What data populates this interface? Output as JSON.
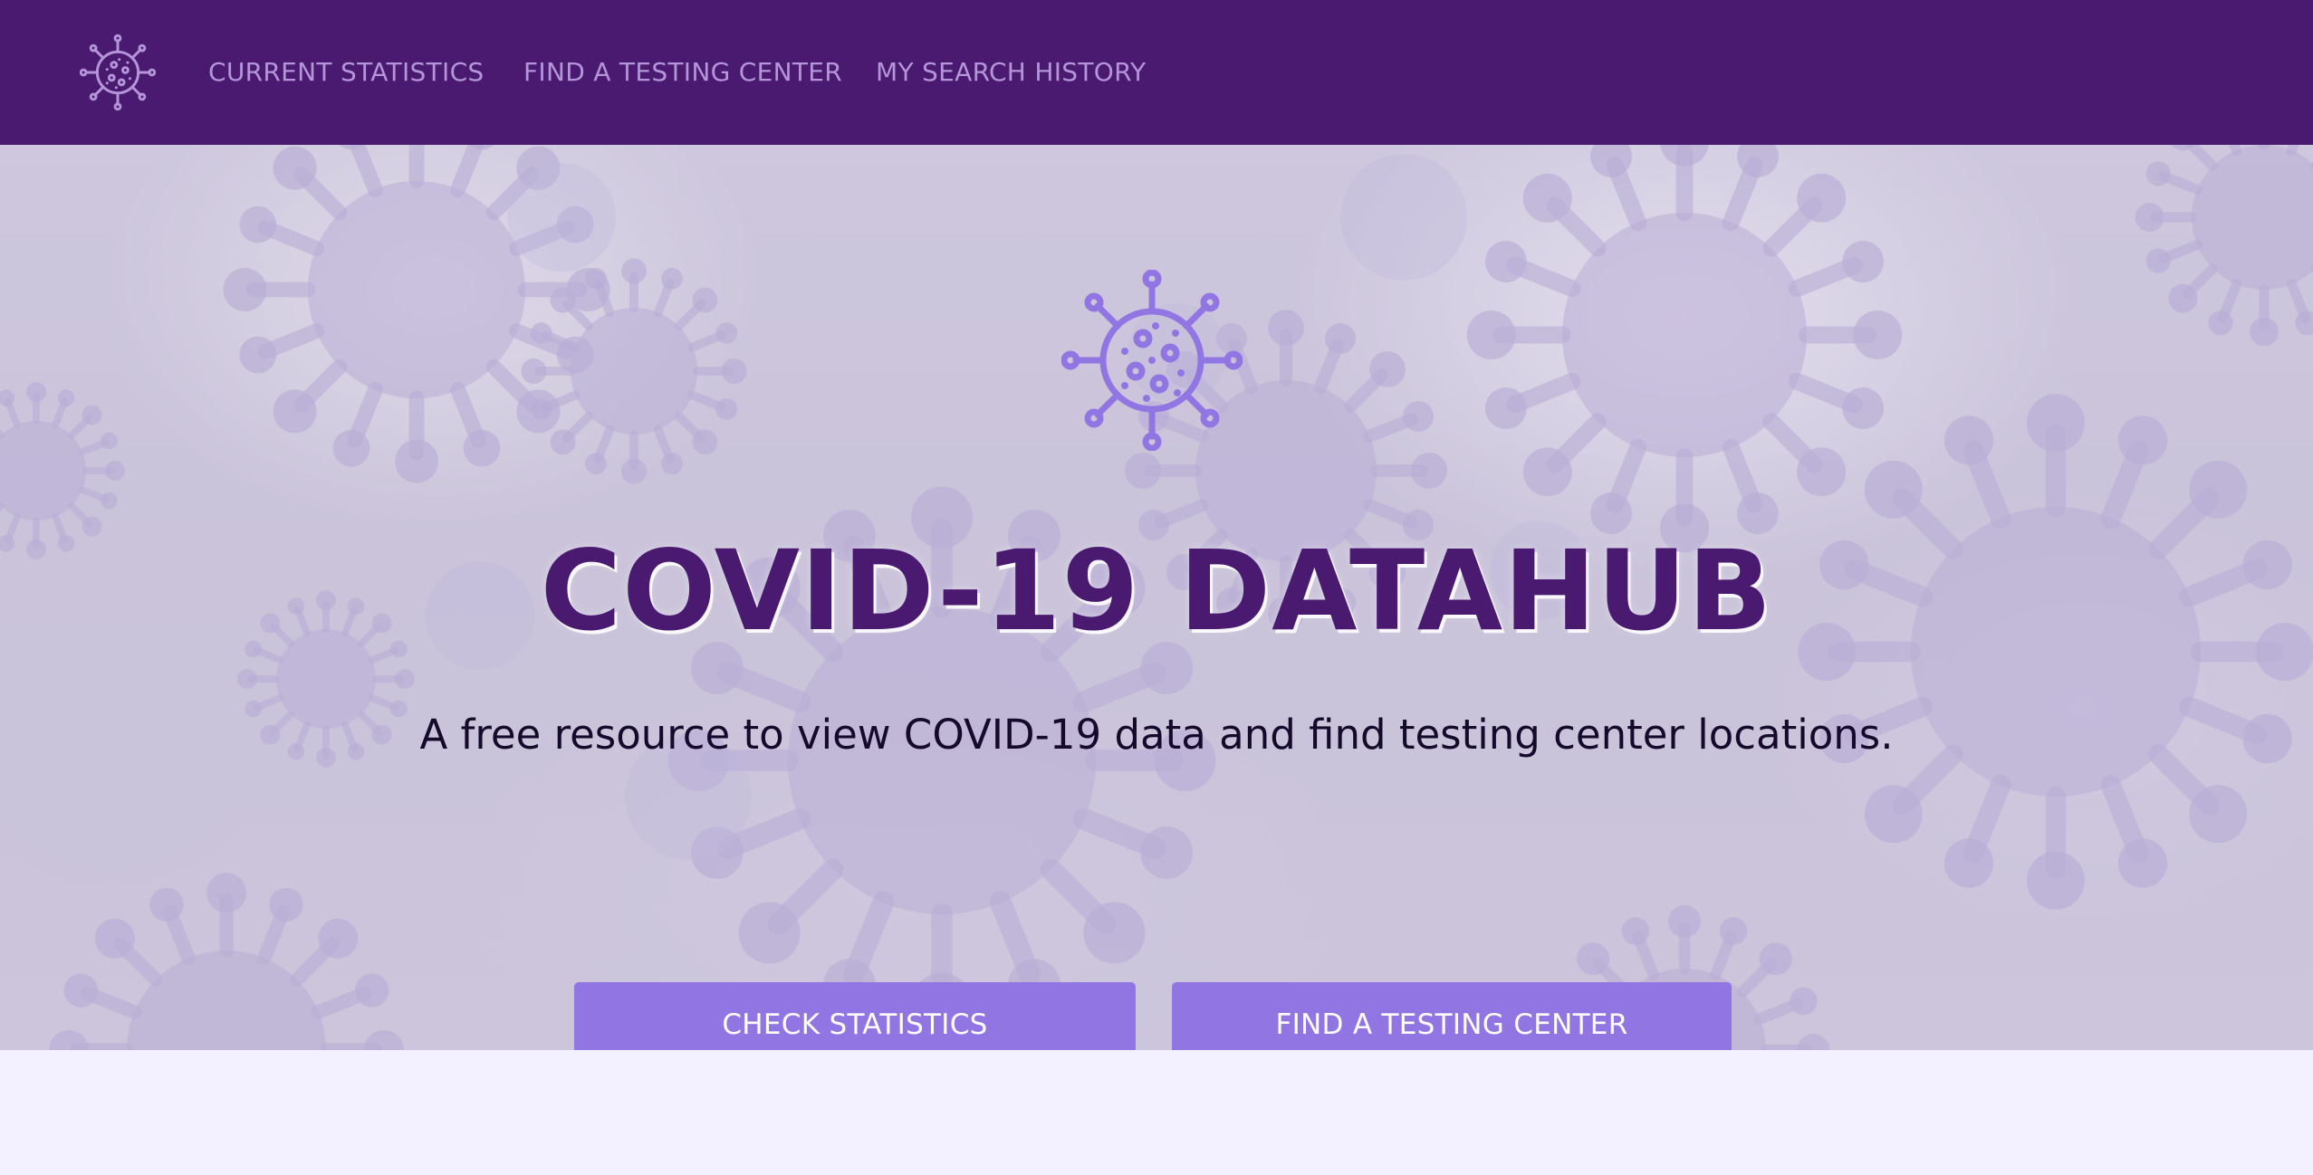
{
  "nav": {
    "logo_icon": "virus-icon",
    "links": [
      {
        "label": "CURRENT STATISTICS"
      },
      {
        "label": "FIND A TESTING CENTER"
      },
      {
        "label": "MY SEARCH HISTORY"
      }
    ]
  },
  "hero": {
    "icon": "virus-icon",
    "title": "COVID-19 DATAHUB",
    "subtitle": "A free resource to view COVID-19 data and find testing center locations.",
    "buttons": [
      {
        "label": "CHECK STATISTICS"
      },
      {
        "label": "FIND A TESTING CENTER"
      }
    ]
  },
  "colors": {
    "navbar": "#4a1a70",
    "nav_link": "#b495d9",
    "title": "#4a1a70",
    "button": "#9176e3",
    "page_background": "#f3f0ff"
  }
}
